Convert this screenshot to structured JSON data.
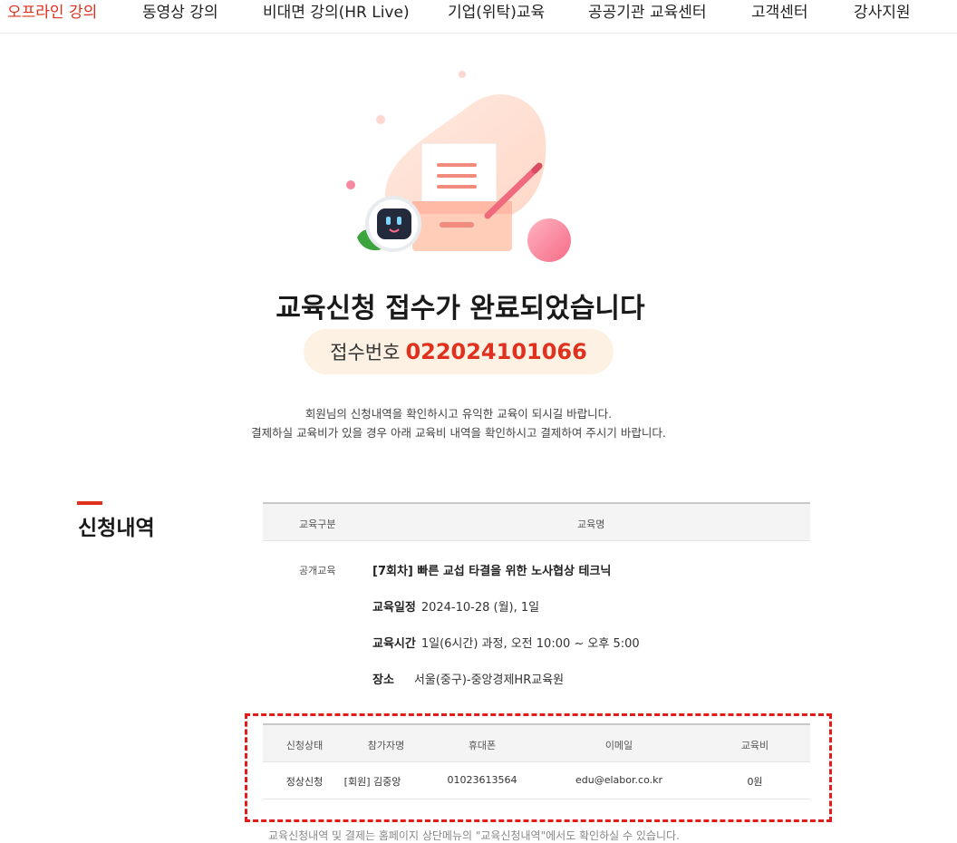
{
  "nav": {
    "items": [
      {
        "label": "오프라인 강의",
        "active": true
      },
      {
        "label": "동영상 강의",
        "active": false
      },
      {
        "label": "비대면 강의(HR Live)",
        "active": false
      },
      {
        "label": "기업(위탁)교육",
        "active": false
      },
      {
        "label": "공공기관 교육센터",
        "active": false
      },
      {
        "label": "고객센터",
        "active": false
      },
      {
        "label": "강사지원",
        "active": false
      }
    ]
  },
  "confirmation": {
    "title": "교육신청 접수가 완료되었습니다",
    "receipt_label": "접수번호",
    "receipt_number": "022024101066",
    "message_line1": "회원님의 신청내역을 확인하시고 유익한 교육이 되시길 바랍니다.",
    "message_line2": "결제하실 교육비가 있을 경우 아래 교육비 내역을 확인하시고 결제하여 주시기 바랍니다."
  },
  "section": {
    "title": "신청내역"
  },
  "course_table": {
    "headers": {
      "category": "교육구분",
      "name": "교육명"
    },
    "category": "공개교육",
    "course_name": "[7회차] 빠른 교섭 타결을 위한 노사협상 테크닉",
    "schedule_label": "교육일정",
    "schedule_value": "2024-10-28 (월), 1일",
    "time_label": "교육시간",
    "time_value": "1일(6시간) 과정, 오전 10:00 ~ 오후 5:00",
    "place_label": "장소",
    "place_value": "서울(중구)-중앙경제HR교육원"
  },
  "applicant_table": {
    "headers": {
      "status": "신청상태",
      "name": "참가자명",
      "phone": "휴대폰",
      "email": "이메일",
      "fee": "교육비"
    },
    "row": {
      "status": "정상신청",
      "name": "[회원] 김중앙",
      "phone": "01023613564",
      "email": "edu@elabor.co.kr",
      "fee": "0원"
    }
  },
  "footnote": "교육신청내역 및 결제는 홈페이지 상단메뉴의 \"교육신청내역\"에서도 확인하실 수 있습니다.",
  "colors": {
    "accent": "#e0311f",
    "highlight_border": "#e31b1b",
    "pill_bg": "#fdf1e3"
  },
  "icons": {
    "illustration": "document-drawer-robot-illustration"
  }
}
